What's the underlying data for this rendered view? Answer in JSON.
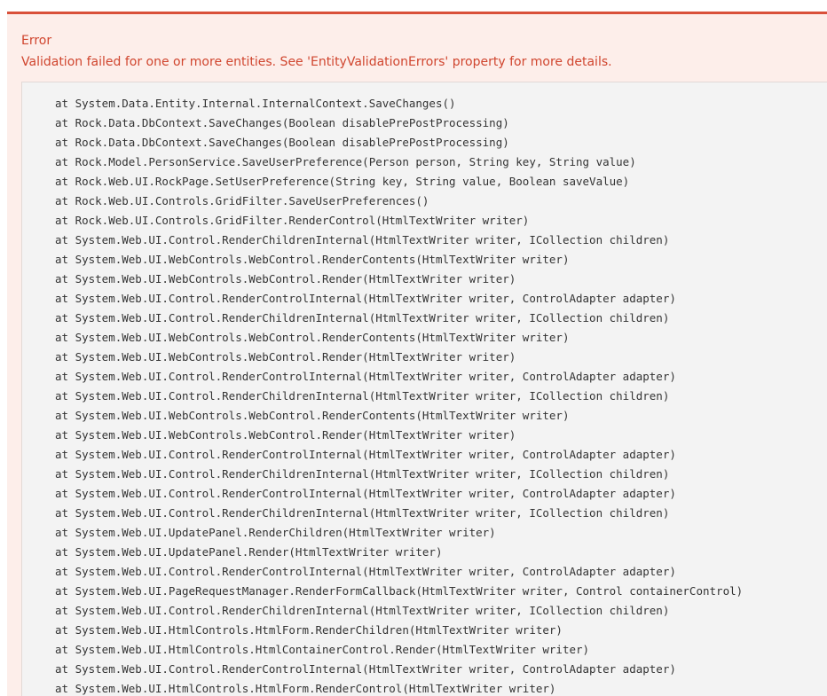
{
  "alert": {
    "title": "Error",
    "message": "Validation failed for one or more entities. See 'EntityValidationErrors' property for more details.",
    "accent_color": "#d9503a",
    "background_color": "#fdeeea"
  },
  "stack_trace": [
    "at System.Data.Entity.Internal.InternalContext.SaveChanges()",
    "at Rock.Data.DbContext.SaveChanges(Boolean disablePrePostProcessing)",
    "at Rock.Data.DbContext.SaveChanges(Boolean disablePrePostProcessing)",
    "at Rock.Model.PersonService.SaveUserPreference(Person person, String key, String value)",
    "at Rock.Web.UI.RockPage.SetUserPreference(String key, String value, Boolean saveValue)",
    "at Rock.Web.UI.Controls.GridFilter.SaveUserPreferences()",
    "at Rock.Web.UI.Controls.GridFilter.RenderControl(HtmlTextWriter writer)",
    "at System.Web.UI.Control.RenderChildrenInternal(HtmlTextWriter writer, ICollection children)",
    "at System.Web.UI.WebControls.WebControl.RenderContents(HtmlTextWriter writer)",
    "at System.Web.UI.WebControls.WebControl.Render(HtmlTextWriter writer)",
    "at System.Web.UI.Control.RenderControlInternal(HtmlTextWriter writer, ControlAdapter adapter)",
    "at System.Web.UI.Control.RenderChildrenInternal(HtmlTextWriter writer, ICollection children)",
    "at System.Web.UI.WebControls.WebControl.RenderContents(HtmlTextWriter writer)",
    "at System.Web.UI.WebControls.WebControl.Render(HtmlTextWriter writer)",
    "at System.Web.UI.Control.RenderControlInternal(HtmlTextWriter writer, ControlAdapter adapter)",
    "at System.Web.UI.Control.RenderChildrenInternal(HtmlTextWriter writer, ICollection children)",
    "at System.Web.UI.WebControls.WebControl.RenderContents(HtmlTextWriter writer)",
    "at System.Web.UI.WebControls.WebControl.Render(HtmlTextWriter writer)",
    "at System.Web.UI.Control.RenderControlInternal(HtmlTextWriter writer, ControlAdapter adapter)",
    "at System.Web.UI.Control.RenderChildrenInternal(HtmlTextWriter writer, ICollection children)",
    "at System.Web.UI.Control.RenderControlInternal(HtmlTextWriter writer, ControlAdapter adapter)",
    "at System.Web.UI.Control.RenderChildrenInternal(HtmlTextWriter writer, ICollection children)",
    "at System.Web.UI.UpdatePanel.RenderChildren(HtmlTextWriter writer)",
    "at System.Web.UI.UpdatePanel.Render(HtmlTextWriter writer)",
    "at System.Web.UI.Control.RenderControlInternal(HtmlTextWriter writer, ControlAdapter adapter)",
    "at System.Web.UI.PageRequestManager.RenderFormCallback(HtmlTextWriter writer, Control containerControl)",
    "at System.Web.UI.Control.RenderChildrenInternal(HtmlTextWriter writer, ICollection children)",
    "at System.Web.UI.HtmlControls.HtmlForm.RenderChildren(HtmlTextWriter writer)",
    "at System.Web.UI.HtmlControls.HtmlContainerControl.Render(HtmlTextWriter writer)",
    "at System.Web.UI.Control.RenderControlInternal(HtmlTextWriter writer, ControlAdapter adapter)",
    "at System.Web.UI.HtmlControls.HtmlForm.RenderControl(HtmlTextWriter writer)"
  ]
}
